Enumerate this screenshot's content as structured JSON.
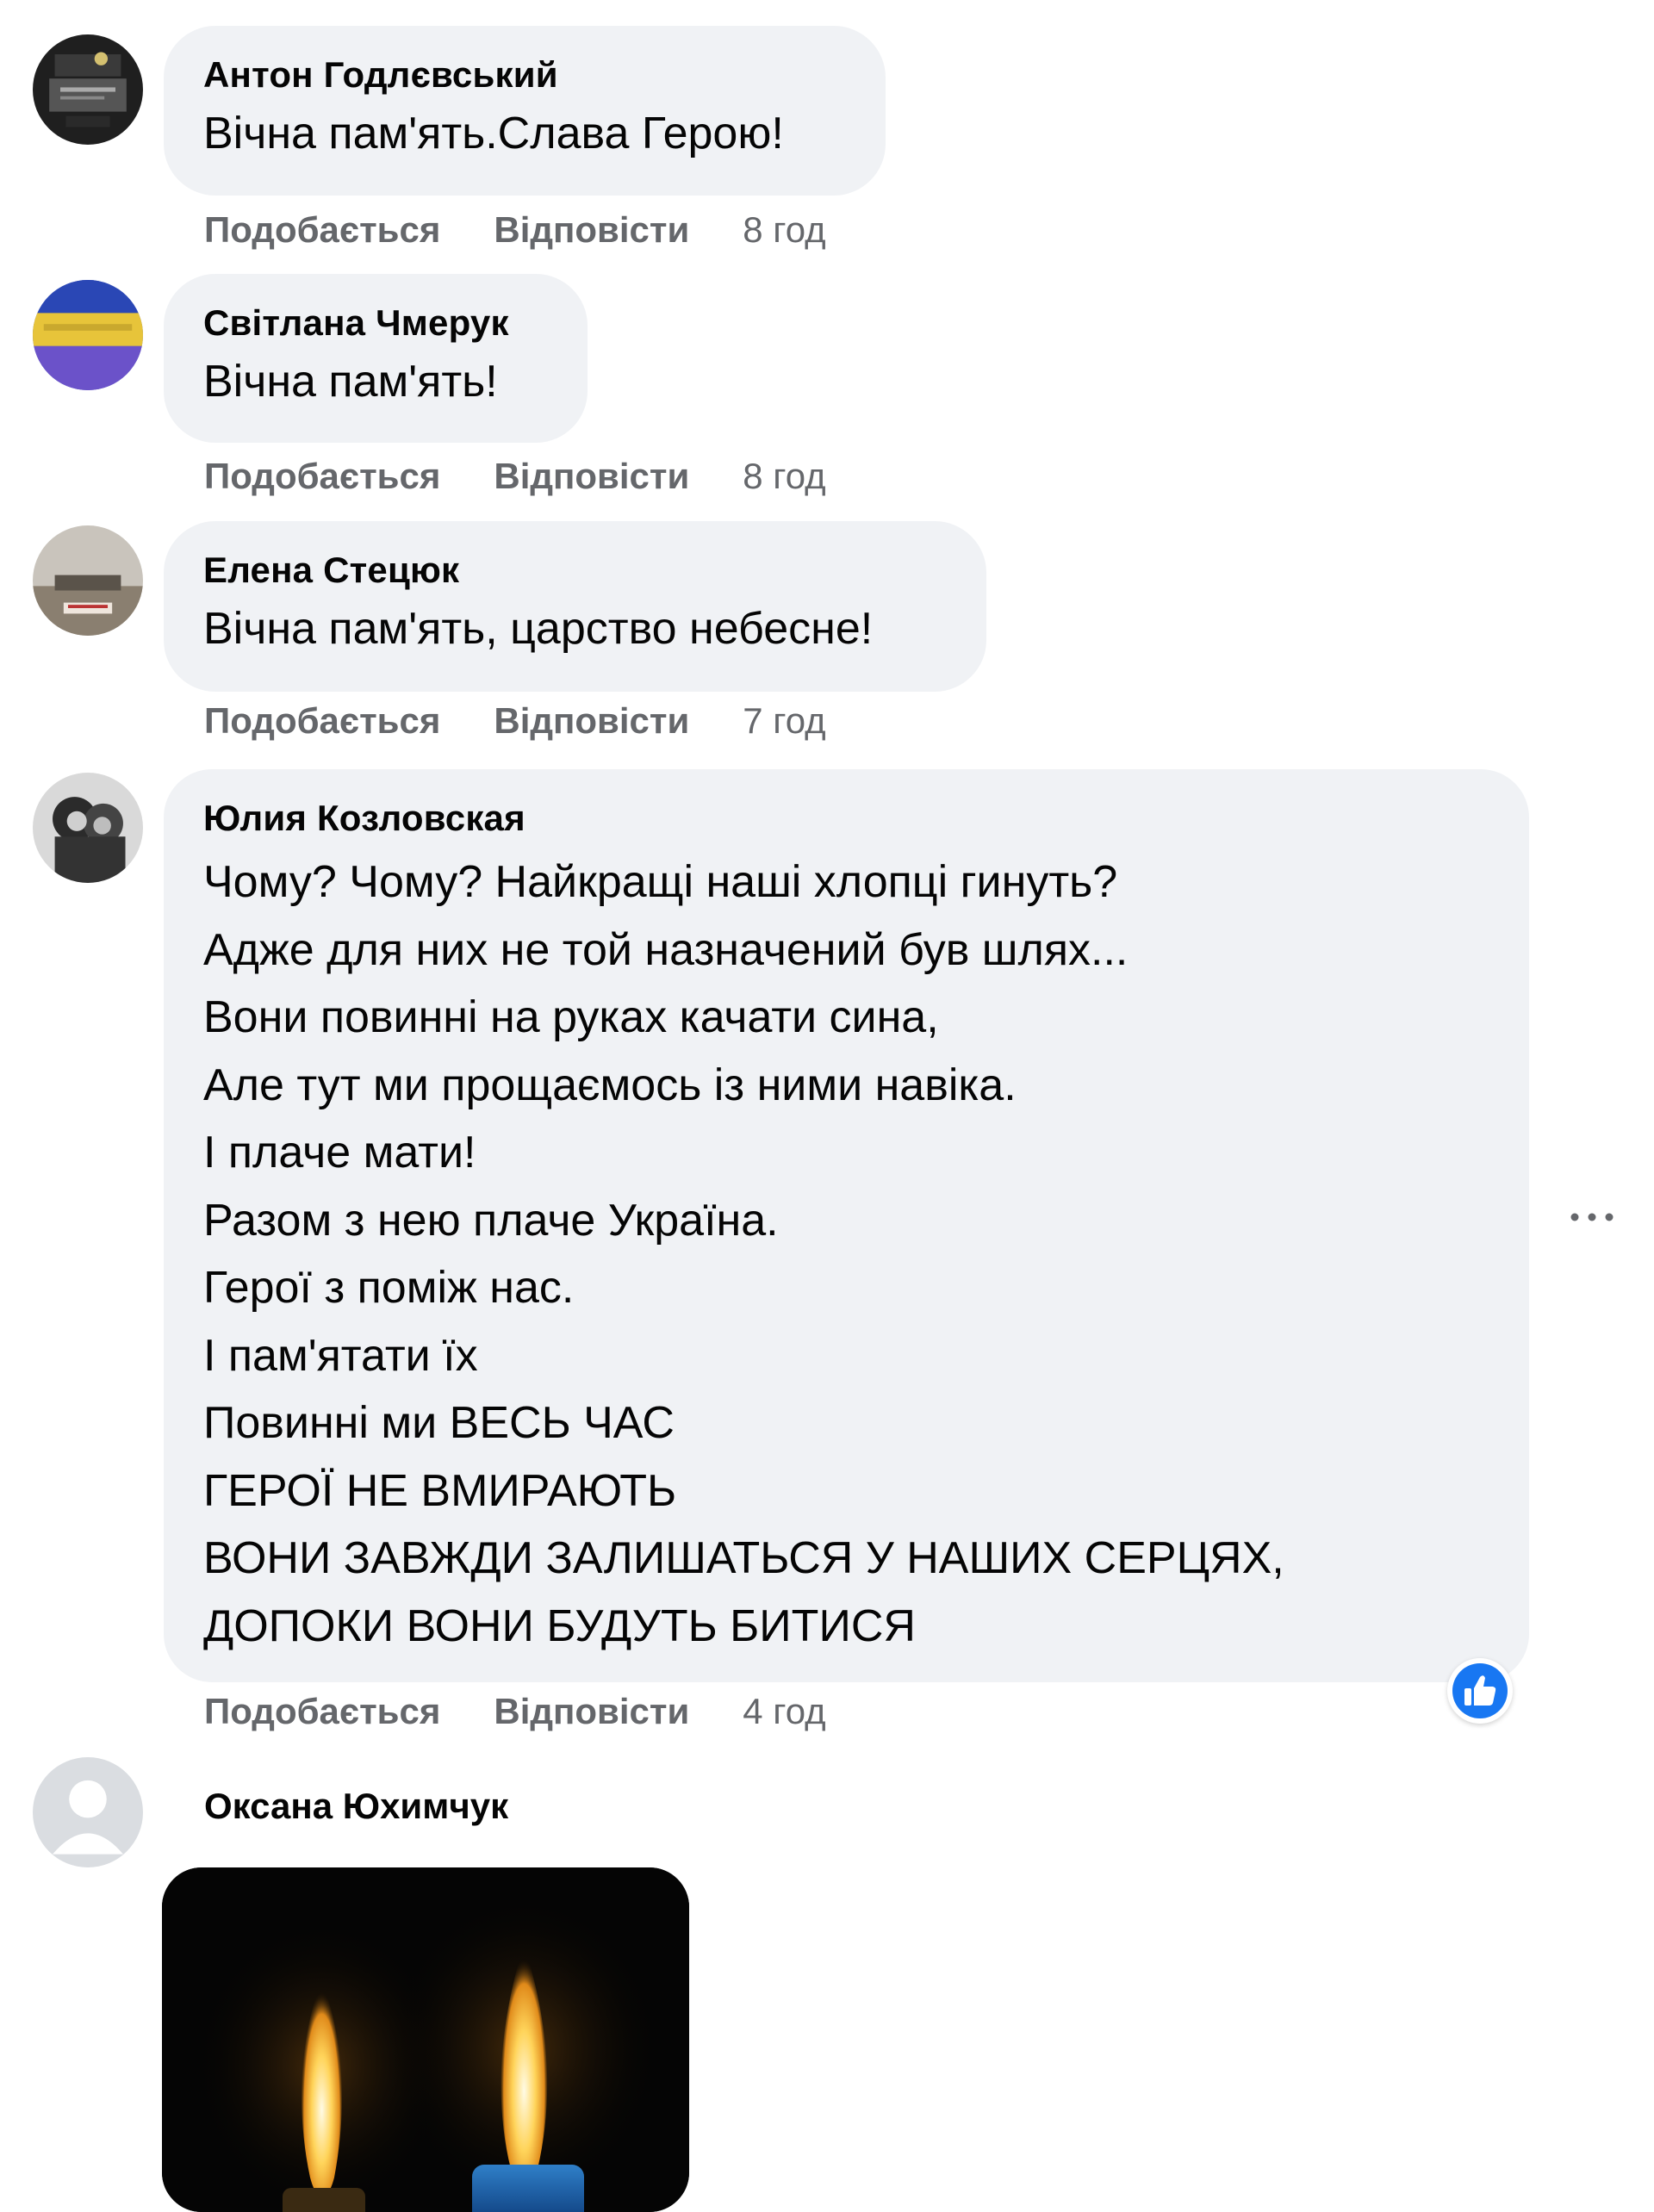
{
  "comments": [
    {
      "author": "Антон Годлєвський",
      "text": "Вічна пам'ять.Слава Герою!",
      "like_label": "Подобається",
      "reply_label": "Відповісти",
      "time": "8 год"
    },
    {
      "author": "Світлана Чмерук",
      "text": "Вічна пам'ять!",
      "like_label": "Подобається",
      "reply_label": "Відповісти",
      "time": "8 год"
    },
    {
      "author": "Елена Стецюк",
      "text": "Вічна пам'ять, царство небесне!",
      "like_label": "Подобається",
      "reply_label": "Відповісти",
      "time": "7 год"
    },
    {
      "author": "Юлия Козловская",
      "lines": [
        "Чому? Чому? Найкращі наші хлопці гинуть?",
        "Адже для них не той назначений був шлях...",
        "Вони повинні на руках качати сина,",
        "Але тут ми прощаємось із ними навіка.",
        "І плаче мати!",
        "Разом з нею плаче Україна.",
        "Герої з поміж нас.",
        "І пам'ятати їх",
        "Повинні ми ВЕСЬ ЧАС",
        "ГЕРОЇ НЕ ВМИРАЮТЬ",
        "ВОНИ ЗАВЖДИ ЗАЛИШАТЬСЯ У НАШИХ СЕРЦЯХ,",
        "ДОПОКИ ВОНИ БУДУТЬ БИТИСЯ"
      ],
      "like_label": "Подобається",
      "reply_label": "Відповісти",
      "time": "4 год",
      "reaction_icon": "thumbs-up-icon"
    },
    {
      "author": "Оксана Юхимчук",
      "attachment_icon": "candles-photo"
    }
  ],
  "more_icon": "ellipsis-icon",
  "colors": {
    "bubble": "#f0f2f5",
    "meta_text": "#65676b",
    "like_blue": "#1877f2"
  }
}
